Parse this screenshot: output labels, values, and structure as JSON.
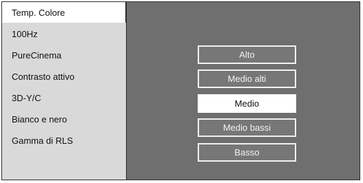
{
  "sidebar": {
    "items": [
      {
        "label": "Temp. Colore",
        "selected": true
      },
      {
        "label": "100Hz",
        "selected": false
      },
      {
        "label": "PureCinema",
        "selected": false
      },
      {
        "label": "Contrasto attivo",
        "selected": false
      },
      {
        "label": "3D-Y/C",
        "selected": false
      },
      {
        "label": "Bianco e nero",
        "selected": false
      },
      {
        "label": "Gamma di RLS",
        "selected": false
      }
    ]
  },
  "options": {
    "items": [
      {
        "label": "Alto",
        "selected": false
      },
      {
        "label": "Medio alti",
        "selected": false
      },
      {
        "label": "Medio",
        "selected": true
      },
      {
        "label": "Medio bassi",
        "selected": false
      },
      {
        "label": "Basso",
        "selected": false
      }
    ]
  },
  "colors": {
    "panel_bg": "#6f6f6f",
    "sidebar_bg": "#d9d9d9",
    "selected_bg": "#ffffff",
    "option_bg": "#777777",
    "option_border": "#f2f2f2"
  }
}
